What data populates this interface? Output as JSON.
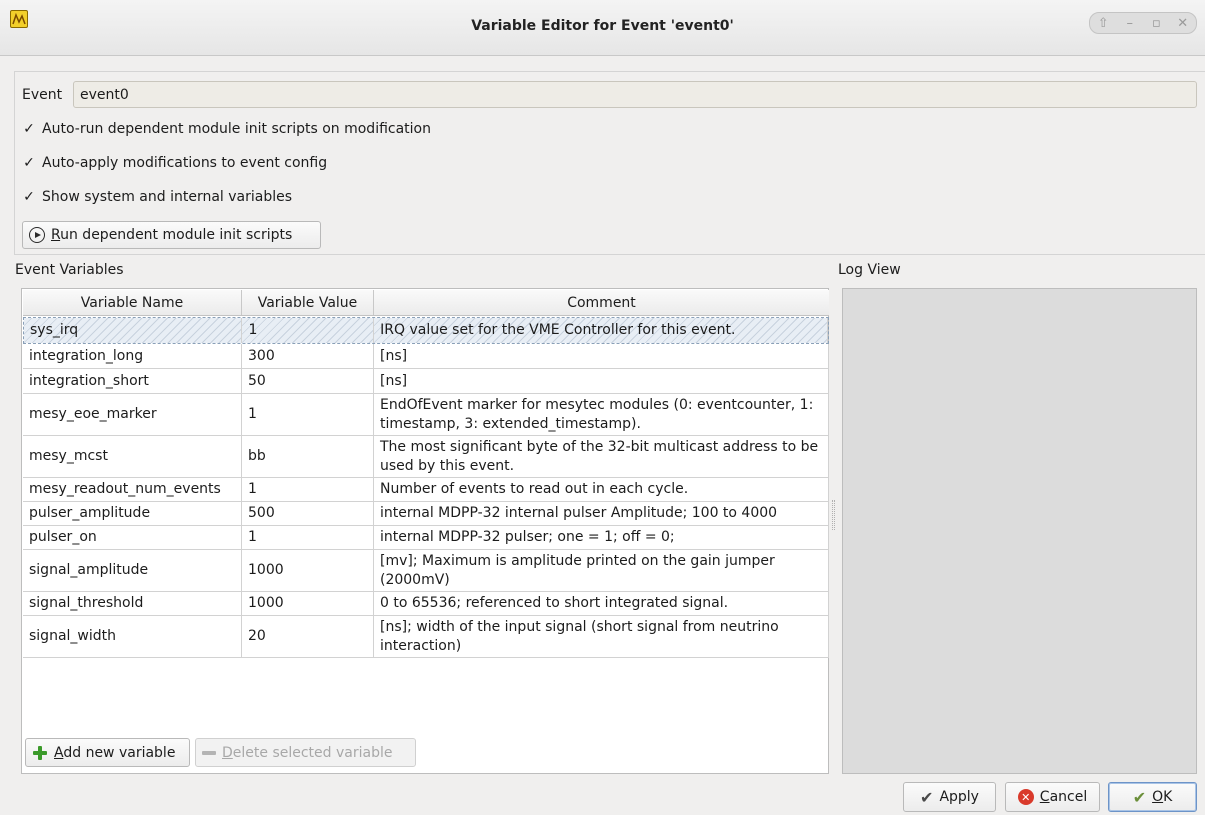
{
  "window": {
    "title": "Variable Editor for Event 'event0'",
    "controls": [
      "⇧",
      "–",
      "▫",
      "✕"
    ]
  },
  "event": {
    "label": "Event",
    "value": "event0"
  },
  "options": {
    "auto_run": {
      "label": "Auto-run dependent module init scripts on modification",
      "checked": true
    },
    "auto_apply": {
      "label": "Auto-apply modifications to event config",
      "checked": true
    },
    "show_system": {
      "label": "Show system and internal variables",
      "checked": true
    },
    "check_glyph": "✓"
  },
  "run_button": {
    "prefix": "",
    "mnemonic": "R",
    "rest": "un dependent module init scripts"
  },
  "event_variables": {
    "label": "Event Variables",
    "columns": [
      "Variable Name",
      "Variable Value",
      "Comment"
    ],
    "rows": [
      {
        "name": "sys_irq",
        "value": "1",
        "comment": "IRQ value set for the VME Controller for this event."
      },
      {
        "name": "integration_long",
        "value": "300",
        "comment": "[ns]"
      },
      {
        "name": "integration_short",
        "value": "50",
        "comment": "[ns]"
      },
      {
        "name": "mesy_eoe_marker",
        "value": "1",
        "comment": "EndOfEvent marker for mesytec modules (0: eventcounter, 1: timestamp, 3: extended_timestamp)."
      },
      {
        "name": "mesy_mcst",
        "value": "bb",
        "comment": "The most significant byte of the 32-bit multicast address to be used by this event."
      },
      {
        "name": "mesy_readout_num_events",
        "value": "1",
        "comment": "Number of events to read out in each cycle."
      },
      {
        "name": "pulser_amplitude",
        "value": "500",
        "comment": "internal MDPP-32 internal pulser Amplitude; 100 to 4000"
      },
      {
        "name": "pulser_on",
        "value": "1",
        "comment": "internal MDPP-32 pulser; one = 1; off = 0;"
      },
      {
        "name": "signal_amplitude",
        "value": "1000",
        "comment": "[mv]; Maximum is amplitude printed on the gain jumper (2000mV)"
      },
      {
        "name": "signal_threshold",
        "value": "1000",
        "comment": "0 to 65536; referenced to short integrated signal."
      },
      {
        "name": "signal_width",
        "value": "20",
        "comment": "[ns]; width of the input signal (short signal from neutrino interaction)"
      }
    ],
    "add_button": {
      "mnemonic": "A",
      "rest": "dd new variable"
    },
    "delete_button": {
      "mnemonic": "D",
      "rest": "elete selected variable"
    }
  },
  "log_view": {
    "label": "Log View"
  },
  "dialog_buttons": {
    "apply": "Apply",
    "cancel": {
      "mnemonic": "C",
      "rest": "ancel"
    },
    "ok": {
      "mnemonic": "O",
      "rest": "K"
    }
  }
}
